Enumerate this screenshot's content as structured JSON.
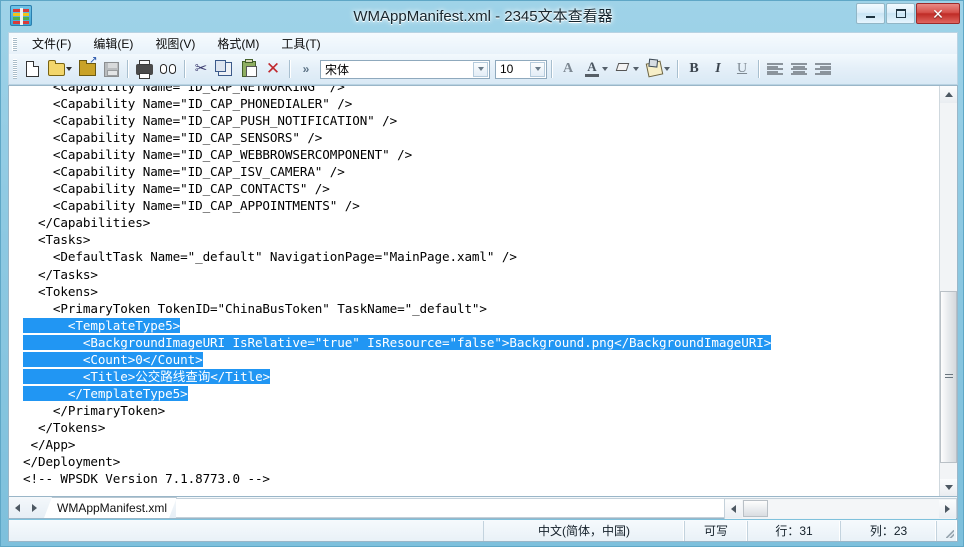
{
  "window": {
    "title": "WMAppManifest.xml - 2345文本查看器",
    "app_icon": "archive-stack-icon",
    "controls": {
      "minimize": "minimize-icon",
      "maximize": "maximize-icon",
      "close": "✕"
    }
  },
  "menu": {
    "items": [
      {
        "name": "file",
        "label": "文件(F)"
      },
      {
        "name": "edit",
        "label": "编辑(E)"
      },
      {
        "name": "view",
        "label": "视图(V)"
      },
      {
        "name": "format",
        "label": "格式(M)"
      },
      {
        "name": "tools",
        "label": "工具(T)"
      }
    ]
  },
  "toolbar": {
    "new_tip": "新建",
    "open_tip": "打开",
    "saveas_tip": "另存为",
    "save_tip": "保存",
    "print_tip": "打印",
    "find_tip": "查找",
    "cut_tip": "剪切",
    "copy_tip": "复制",
    "paste_tip": "粘贴",
    "delete_tip": "删除",
    "overflow_label": "»",
    "font_name": "宋体",
    "font_size": "10",
    "cut_glyph": "✂",
    "delete_glyph": "✕",
    "bold_label": "B",
    "italic_label": "I",
    "underline_label": "U",
    "font_grow_label": "A",
    "font_color_label": "A"
  },
  "editor": {
    "lines": [
      {
        "text": "    <Capability Name=\"ID_CAP_NETWORKING\" />",
        "selected": false
      },
      {
        "text": "    <Capability Name=\"ID_CAP_PHONEDIALER\" />",
        "selected": false
      },
      {
        "text": "    <Capability Name=\"ID_CAP_PUSH_NOTIFICATION\" />",
        "selected": false
      },
      {
        "text": "    <Capability Name=\"ID_CAP_SENSORS\" />",
        "selected": false
      },
      {
        "text": "    <Capability Name=\"ID_CAP_WEBBROWSERCOMPONENT\" />",
        "selected": false
      },
      {
        "text": "    <Capability Name=\"ID_CAP_ISV_CAMERA\" />",
        "selected": false
      },
      {
        "text": "    <Capability Name=\"ID_CAP_CONTACTS\" />",
        "selected": false
      },
      {
        "text": "    <Capability Name=\"ID_CAP_APPOINTMENTS\" />",
        "selected": false
      },
      {
        "text": "  </Capabilities>",
        "selected": false
      },
      {
        "text": "  <Tasks>",
        "selected": false
      },
      {
        "text": "    <DefaultTask Name=\"_default\" NavigationPage=\"MainPage.xaml\" />",
        "selected": false
      },
      {
        "text": "  </Tasks>",
        "selected": false
      },
      {
        "text": "  <Tokens>",
        "selected": false
      },
      {
        "text": "    <PrimaryToken TokenID=\"ChinaBusToken\" TaskName=\"_default\">",
        "selected": false
      },
      {
        "text": "      <TemplateType5>",
        "selected": true
      },
      {
        "text": "        <BackgroundImageURI IsRelative=\"true\" IsResource=\"false\">Background.png</BackgroundImageURI>",
        "selected": true
      },
      {
        "text": "        <Count>0</Count>",
        "selected": true
      },
      {
        "text": "        <Title>公交路线查询</Title>",
        "selected": true
      },
      {
        "text": "      </TemplateType5>",
        "selected": true
      },
      {
        "text": "    </PrimaryToken>",
        "selected": false
      },
      {
        "text": "  </Tokens>",
        "selected": false
      },
      {
        "text": " </App>",
        "selected": false
      },
      {
        "text": "</Deployment>",
        "selected": false
      },
      {
        "text": "<!-- WPSDK Version 7.1.8773.0 -->",
        "selected": false
      }
    ],
    "selection_color": "#2196f3",
    "selection_text_color": "#ffffff"
  },
  "tabs": {
    "prev_label": "◄",
    "next_label": "►",
    "items": [
      {
        "name": "wmappmanifest",
        "label": "WMAppManifest.xml",
        "active": true
      }
    ]
  },
  "status": {
    "language": "中文(简体，中国)",
    "writable": "可写",
    "row": "行：31",
    "column": "列：23"
  }
}
